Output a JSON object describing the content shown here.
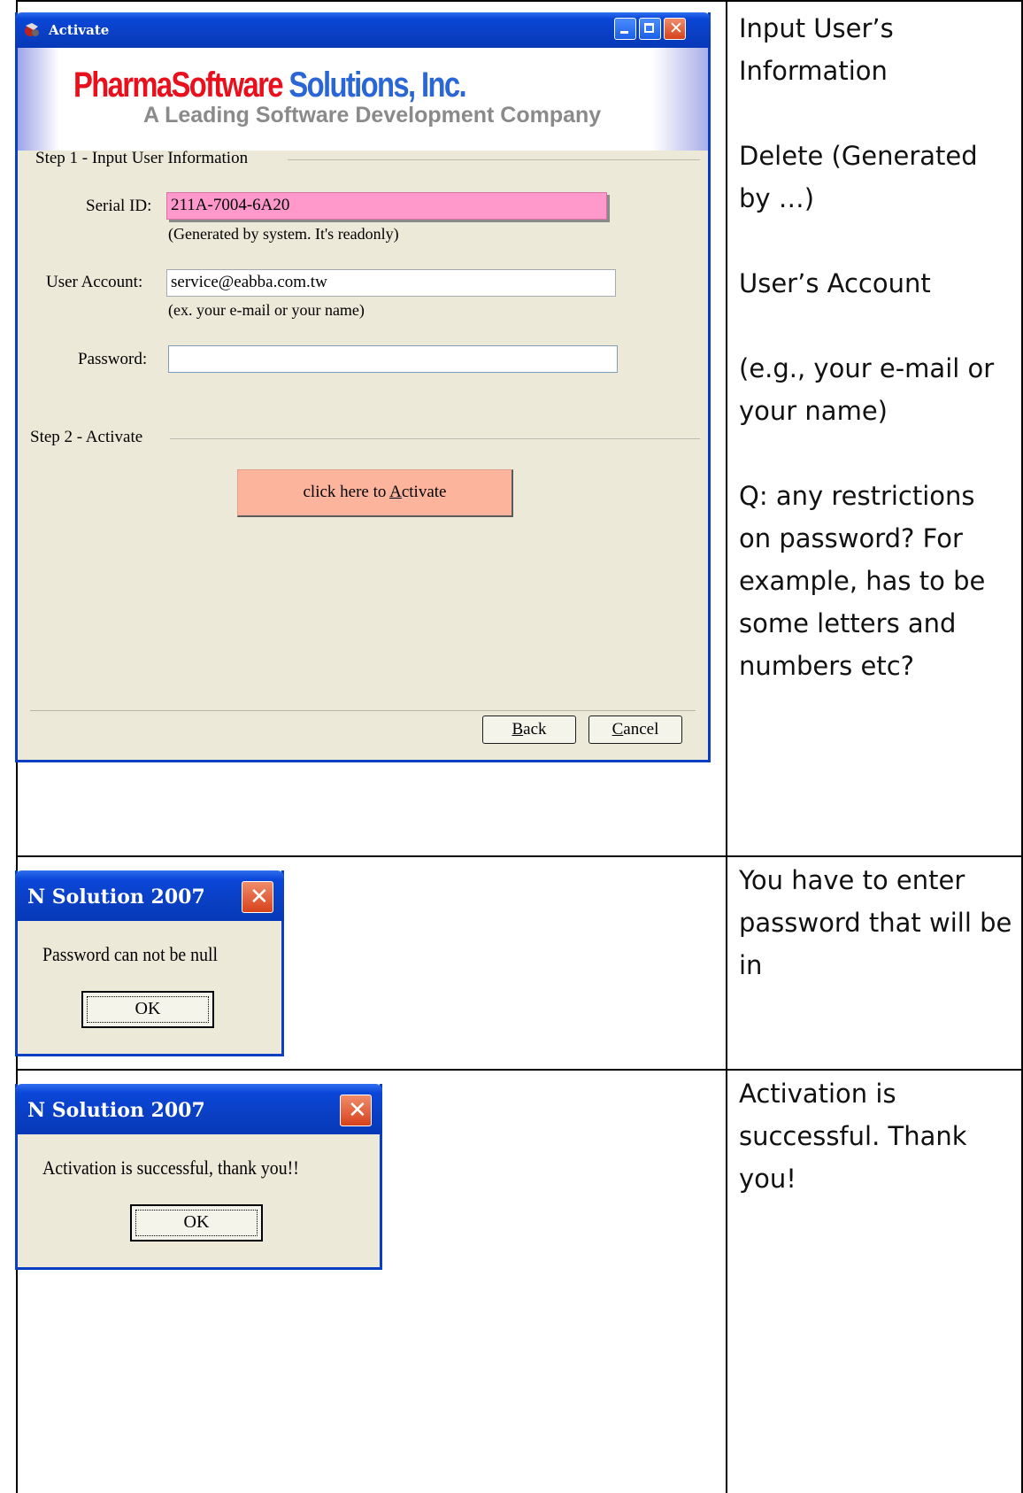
{
  "activate_window": {
    "title": "Activate",
    "banner": {
      "brand_red": "PharmaSoftware",
      "brand_blue": "Solutions, Inc.",
      "tagline": "A Leading Software Development Company"
    },
    "step1_label": "Step 1 - Input User Information",
    "serial_label": "Serial ID:",
    "serial_value": "211A-7004-6A20",
    "serial_hint": "(Generated by system. It's readonly)",
    "account_label": "User Account:",
    "account_value": "service@eabba.com.tw",
    "account_hint": "(ex. your e-mail or your name)",
    "password_label": "Password:",
    "password_value": "",
    "step2_label": "Step 2 - Activate",
    "activate_pre": "click here to ",
    "activate_mn": "A",
    "activate_post": "ctivate",
    "back_mn": "B",
    "back_rest": "ack",
    "cancel_mn": "C",
    "cancel_rest": "ancel"
  },
  "dialog_null": {
    "title": "N Solution 2007",
    "message": "Password can not be null",
    "ok": "OK"
  },
  "dialog_success": {
    "title": "N Solution 2007",
    "message": "Activation is successful, thank you!!",
    "ok": "OK"
  },
  "notes": {
    "row1": [
      "Input User’s Information",
      "Delete (Generated by …)",
      "User’s Account",
      "(e.g., your e-mail or your name)",
      "Q: any restrictions on password? For example, has to be some letters and numbers etc?"
    ],
    "row2": "You have to enter password that will be in",
    "row3": "Activation is successful. Thank you!"
  },
  "colors": {
    "title_blue": "#0a3fc4",
    "serial_bg": "#ff99cc",
    "activate_btn": "#fcb49c",
    "brand_red": "#e8101c",
    "brand_blue": "#2a66d6",
    "tagline_gray": "#8a8a8a"
  }
}
